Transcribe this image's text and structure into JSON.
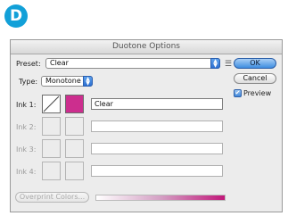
{
  "step_badge": "D",
  "dialog": {
    "title": "Duotone Options",
    "preset": {
      "label": "Preset:",
      "value": "Clear"
    },
    "type": {
      "label": "Type:",
      "value": "Monotone"
    },
    "inks": [
      {
        "label": "Ink 1:",
        "name": "Clear",
        "color": "#cc2e8e",
        "enabled": true
      },
      {
        "label": "Ink 2:",
        "name": "",
        "enabled": false
      },
      {
        "label": "Ink 3:",
        "name": "",
        "enabled": false
      },
      {
        "label": "Ink 4:",
        "name": "",
        "enabled": false
      }
    ],
    "buttons": {
      "ok": "OK",
      "cancel": "Cancel",
      "overprint": "Overprint Colors..."
    },
    "preview": {
      "label": "Preview",
      "checked": true
    }
  }
}
